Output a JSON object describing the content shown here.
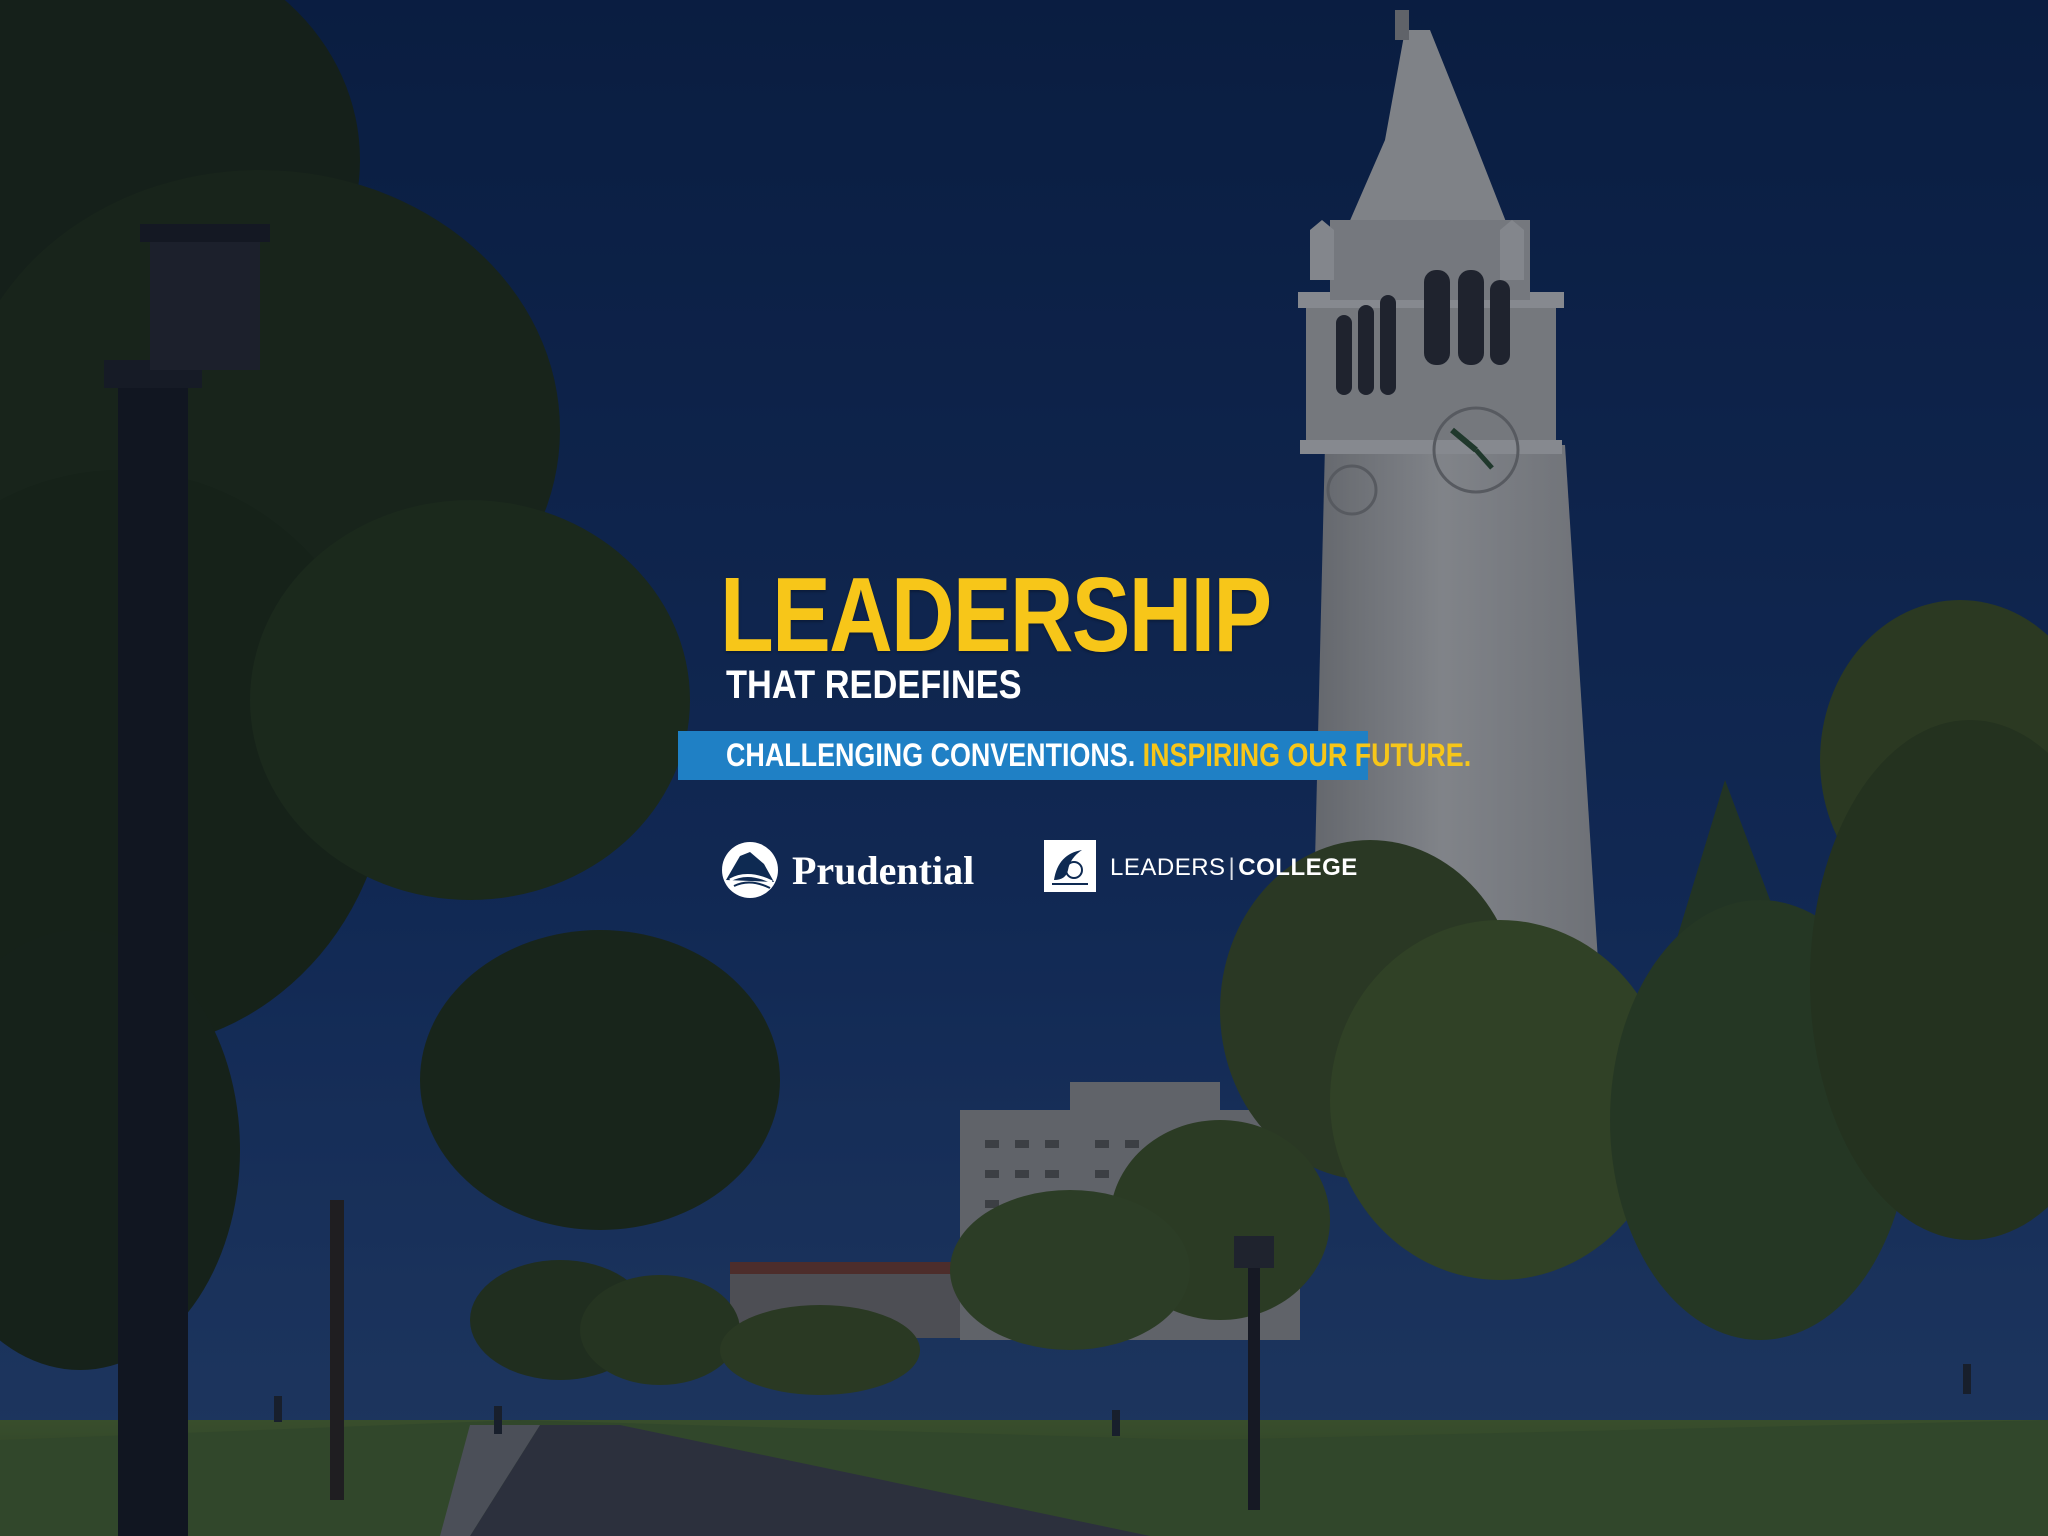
{
  "headline": "LEADERSHIP",
  "subhead": "THAT REDEFINES",
  "banner": {
    "part1": "CHALLENGING CONVENTIONS.",
    "part2": "INSPIRING OUR FUTURE."
  },
  "logos": {
    "prudential": {
      "name": "Prudential",
      "icon": "rock-icon"
    },
    "leaders_college": {
      "word1": "LEADERS",
      "separator": "|",
      "word2": "COLLEGE",
      "icon": "leaders-college-emblem-icon"
    }
  },
  "colors": {
    "sky": "#0e2a52",
    "headline_yellow": "#f7c619",
    "banner_blue": "#1f80c5",
    "foliage": "#2c3b1a",
    "tower": "#b3b3ad"
  }
}
